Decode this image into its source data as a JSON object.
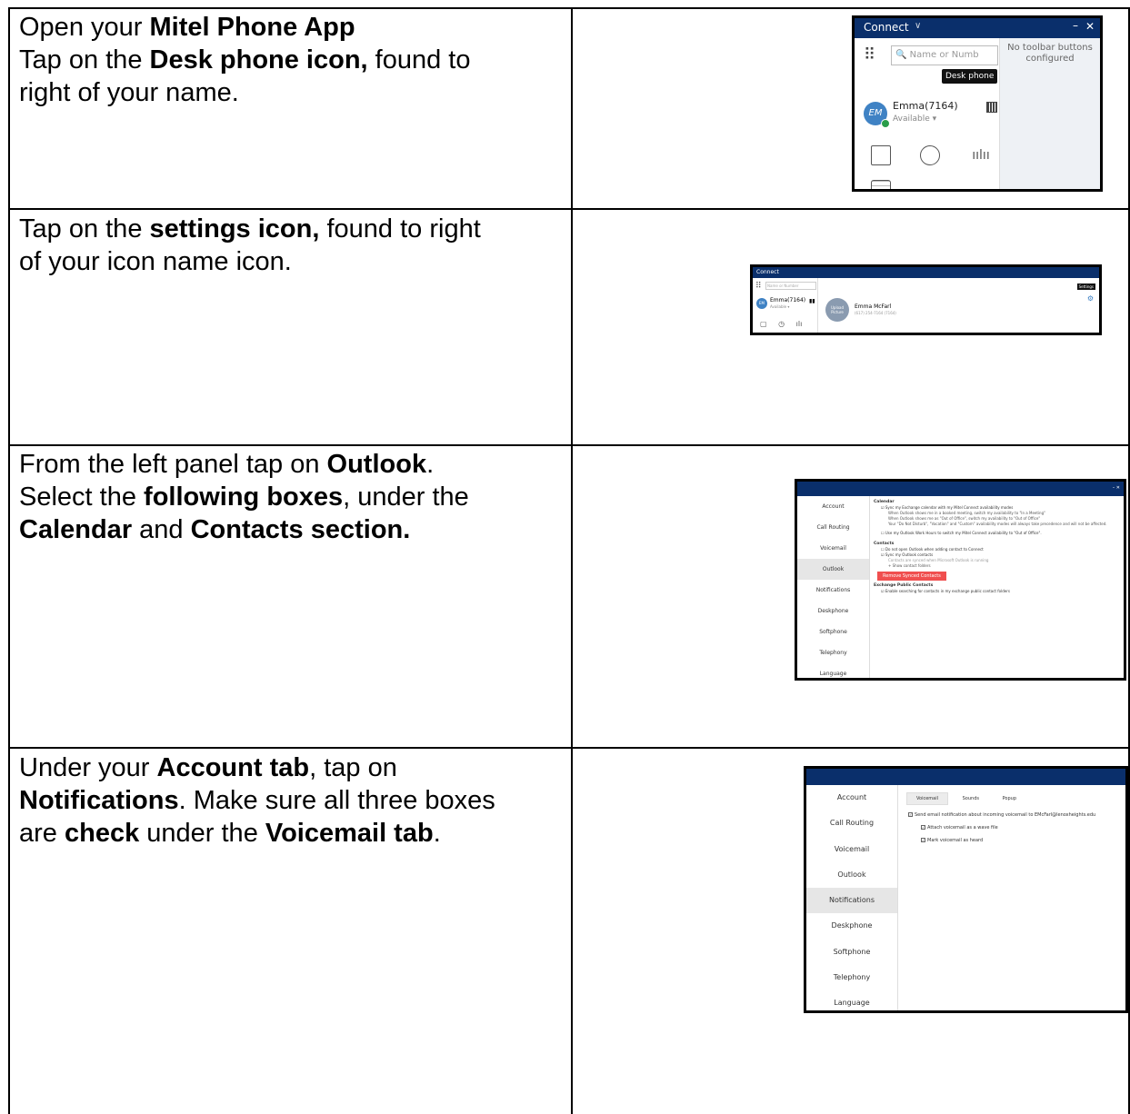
{
  "steps": [
    {
      "lines": [
        [
          {
            "t": "Open your ",
            "b": false
          },
          {
            "t": "Mitel Phone App",
            "b": true
          }
        ],
        [
          {
            "t": "Tap on the ",
            "b": false
          },
          {
            "t": "Desk phone icon,",
            "b": true
          },
          {
            "t": " found to",
            "b": false
          }
        ],
        [
          {
            "t": "right of your name.",
            "b": false
          }
        ]
      ]
    },
    {
      "lines": [
        [
          {
            "t": "Tap on the ",
            "b": false
          },
          {
            "t": "settings icon,",
            "b": true
          },
          {
            "t": " found to right",
            "b": false
          }
        ],
        [
          {
            "t": "of your icon name icon.",
            "b": false
          }
        ]
      ]
    },
    {
      "lines": [
        [
          {
            "t": "From the left panel tap on ",
            "b": false
          },
          {
            "t": "Outlook",
            "b": true
          },
          {
            "t": ".",
            "b": false
          }
        ],
        [
          {
            "t": "Select the ",
            "b": false
          },
          {
            "t": "following boxes",
            "b": true
          },
          {
            "t": ", under the",
            "b": false
          }
        ],
        [
          {
            "t": "Calendar",
            "b": true
          },
          {
            "t": " and ",
            "b": false
          },
          {
            "t": "Contacts section.",
            "b": true
          }
        ]
      ]
    },
    {
      "lines": [
        [
          {
            "t": "Under your ",
            "b": false
          },
          {
            "t": "Account tab",
            "b": true
          },
          {
            "t": ", tap on",
            "b": false
          }
        ],
        [
          {
            "t": "Notifications",
            "b": true
          },
          {
            "t": ". Make sure all three boxes",
            "b": false
          }
        ],
        [
          {
            "t": "are ",
            "b": false
          },
          {
            "t": "check",
            "b": true
          },
          {
            "t": " under the ",
            "b": false
          },
          {
            "t": "Voicemail tab",
            "b": true
          },
          {
            "t": ".",
            "b": false
          }
        ]
      ]
    }
  ],
  "shot1": {
    "title": "Connect",
    "search_placeholder": "Name or Numb",
    "tooltip": "Desk phone",
    "avatar_initials": "EM",
    "name": "Emma(7164)",
    "status": "Available ▾",
    "toolbar_msg": "No toolbar buttons configured"
  },
  "shot2": {
    "title": "Connect",
    "search_placeholder": "Name or Number",
    "avatar_initials": "EM",
    "name": "Emma(7164)",
    "status": "Available ▾",
    "big_avatar_label": "Upload Picture",
    "full_name": "Emma McFarl",
    "extension": "(617) 254-7164 (7164)",
    "tooltip": "Settings"
  },
  "shot3": {
    "nav": [
      "Account",
      "Call Routing",
      "Voicemail",
      "Outlook",
      "Notifications",
      "Deskphone",
      "Softphone",
      "Telephony",
      "Language"
    ],
    "selected": "Outlook",
    "calendar_heading": "Calendar",
    "calendar_opt1": "Sync my Exchange calendar with my Mitel Connect availability modes",
    "calendar_sub1": "When Outlook shows me in a booked meeting, switch my availability to \"In a Meeting\"",
    "calendar_sub2": "When Outlook shows me as \"Out of Office\", switch my availability to \"Out of Office\"",
    "calendar_sub3": "Your \"Do Not Disturb\", \"Vacation\" and \"Custom\" availability modes will always take precedence and will not be affected.",
    "calendar_opt2": "Use my Outlook Work Hours to switch my Mitel Connect availability to \"Out of Office\".",
    "contacts_heading": "Contacts",
    "contacts_opt1": "Do not open Outlook when adding contact to Connect",
    "contacts_opt2": "Sync my Outlook contacts",
    "contacts_note": "Contacts are synced when Microsoft Outlook is running",
    "show_folders": "+ Show contact folders",
    "remove_button": "Remove Synced Contacts",
    "exchange_heading": "Exchange Public Contacts",
    "exchange_opt": "Enable searching for contacts in my exchange public contact folders"
  },
  "shot4": {
    "nav": [
      "Account",
      "Call Routing",
      "Voicemail",
      "Outlook",
      "Notifications",
      "Deskphone",
      "Softphone",
      "Telephony",
      "Language"
    ],
    "selected": "Notifications",
    "tabs": [
      "Voicemail",
      "Sounds",
      "Popup"
    ],
    "active_tab": "Voicemail",
    "opt1": "Send email notification about incoming voicemail to EMcFarl@lenoxheights.edu",
    "opt2": "Attach voicemail as a wave file",
    "opt3": "Mark voicemail as heard"
  }
}
